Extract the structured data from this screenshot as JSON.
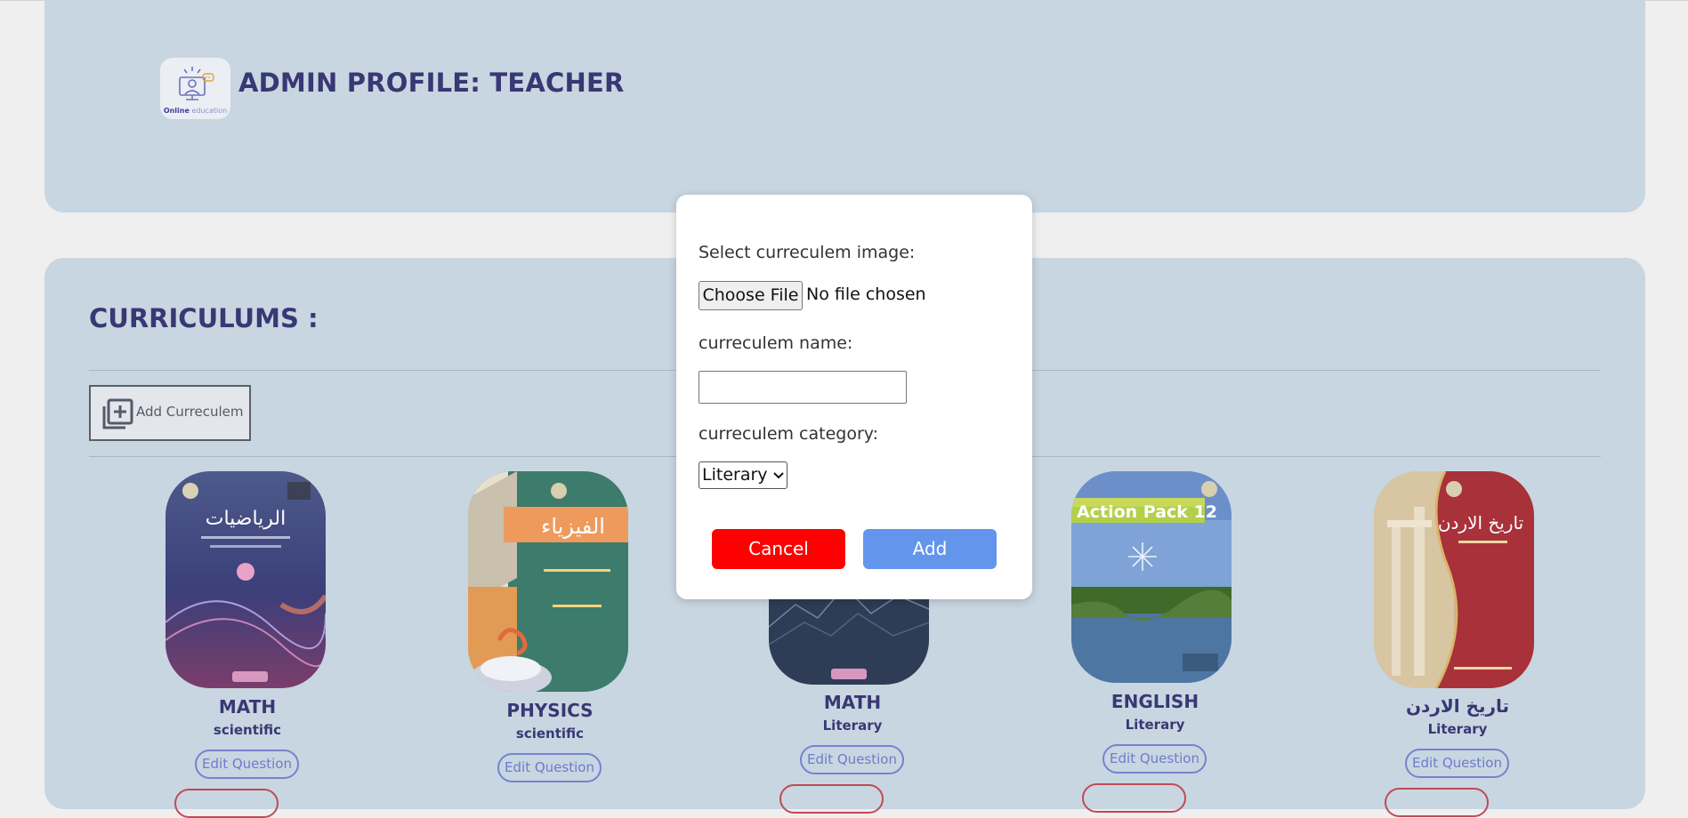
{
  "header": {
    "logo": {
      "text_bold": "Online",
      "text_light": "education",
      "icon": "online-education-logo"
    },
    "title": "ADMIN PROFILE: TEACHER"
  },
  "main": {
    "title": "CURRICULUMS :",
    "add_button": {
      "label": "Add Curreculem",
      "icon": "add-box-icon"
    },
    "cards": [
      {
        "name": "MATH",
        "category": "scientific",
        "edit_label": "Edit Question",
        "cover_title": "الرياضيات",
        "cover_color": "#4b5b8f"
      },
      {
        "name": "PHYSICS",
        "category": "scientific",
        "edit_label": "Edit Question",
        "cover_title": "الفيزياء",
        "cover_color": "#3e7a6b"
      },
      {
        "name": "MATH",
        "category": "Literary",
        "edit_label": "Edit Question",
        "cover_color": "#34465f"
      },
      {
        "name": "ENGLISH",
        "category": "Literary",
        "edit_label": "Edit Question",
        "cover_title": "Action Pack 12",
        "cover_color": "#5e86c4"
      },
      {
        "name": "تاريخ الاردن",
        "category": "Literary",
        "edit_label": "Edit Question",
        "cover_title": "تاريخ الاردن",
        "cover_color": "#a8313a"
      }
    ]
  },
  "modal": {
    "image_label": "Select curreculem image:",
    "file_button": "Choose File",
    "file_status": "No file chosen",
    "name_label": "curreculem name:",
    "name_value": "",
    "category_label": "curreculem category:",
    "category_selected": "Literary",
    "cancel_label": "Cancel",
    "add_label": "Add"
  },
  "colors": {
    "panel": "#c8d6e1",
    "title_text": "#383874",
    "cancel": "#ff0000",
    "add": "#6495ed",
    "edit_border": "#7582cf",
    "delete_border": "#c04a55"
  }
}
